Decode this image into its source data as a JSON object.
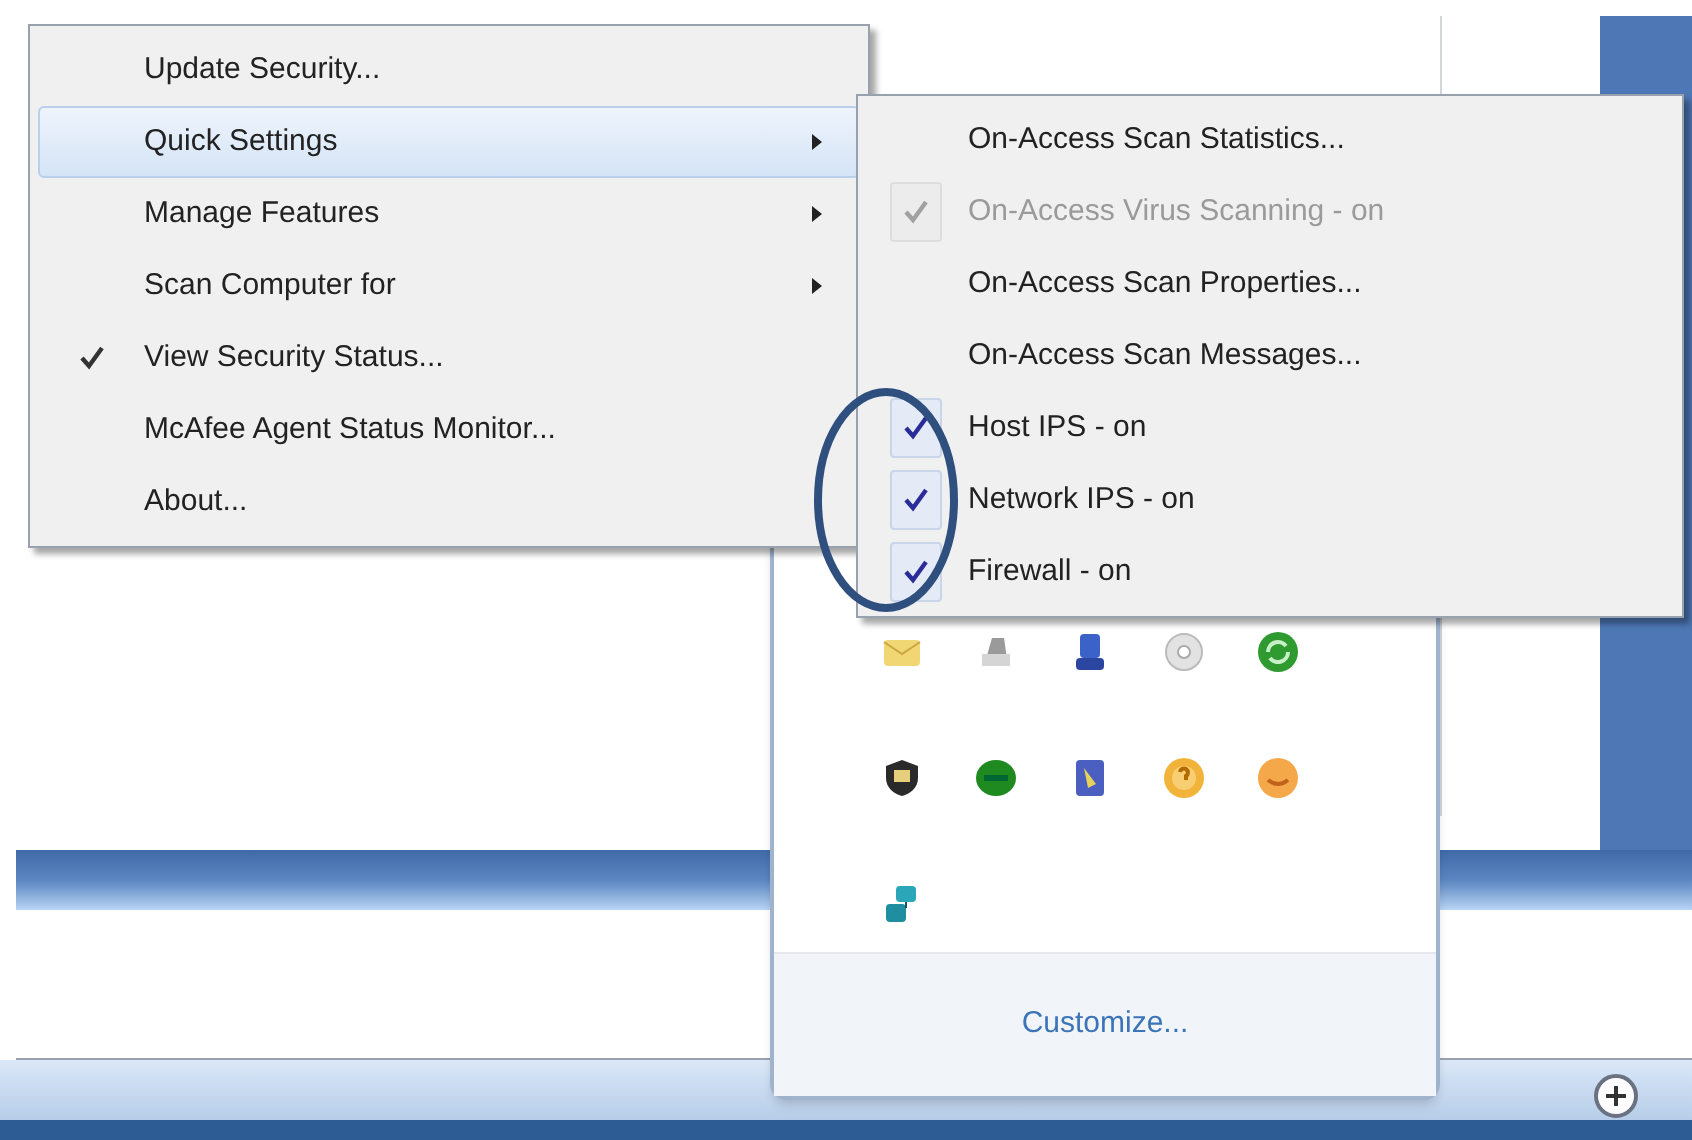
{
  "context_menu": {
    "items": [
      {
        "label": "Update Security...",
        "checked": false,
        "selected": false,
        "submenu": false
      },
      {
        "label": "Quick Settings",
        "checked": false,
        "selected": true,
        "submenu": true
      },
      {
        "label": "Manage Features",
        "checked": false,
        "selected": false,
        "submenu": true
      },
      {
        "label": "Scan Computer for",
        "checked": false,
        "selected": false,
        "submenu": true
      },
      {
        "label": "View Security Status...",
        "checked": true,
        "selected": false,
        "submenu": false
      },
      {
        "label": "McAfee Agent Status Monitor...",
        "checked": false,
        "selected": false,
        "submenu": false
      },
      {
        "label": "About...",
        "checked": false,
        "selected": false,
        "submenu": false
      }
    ]
  },
  "submenu": {
    "items": [
      {
        "label": "On-Access Scan Statistics...",
        "checked": false,
        "disabled": false
      },
      {
        "label": "On-Access Virus Scanning - on",
        "checked": true,
        "disabled": true
      },
      {
        "label": "On-Access Scan Properties...",
        "checked": false,
        "disabled": false
      },
      {
        "label": "On-Access Scan Messages...",
        "checked": false,
        "disabled": false
      },
      {
        "label": "Host IPS - on",
        "checked": true,
        "disabled": false
      },
      {
        "label": "Network IPS - on",
        "checked": true,
        "disabled": false
      },
      {
        "label": "Firewall - on",
        "checked": true,
        "disabled": false
      }
    ]
  },
  "tray_popup": {
    "link": "Customize..."
  }
}
